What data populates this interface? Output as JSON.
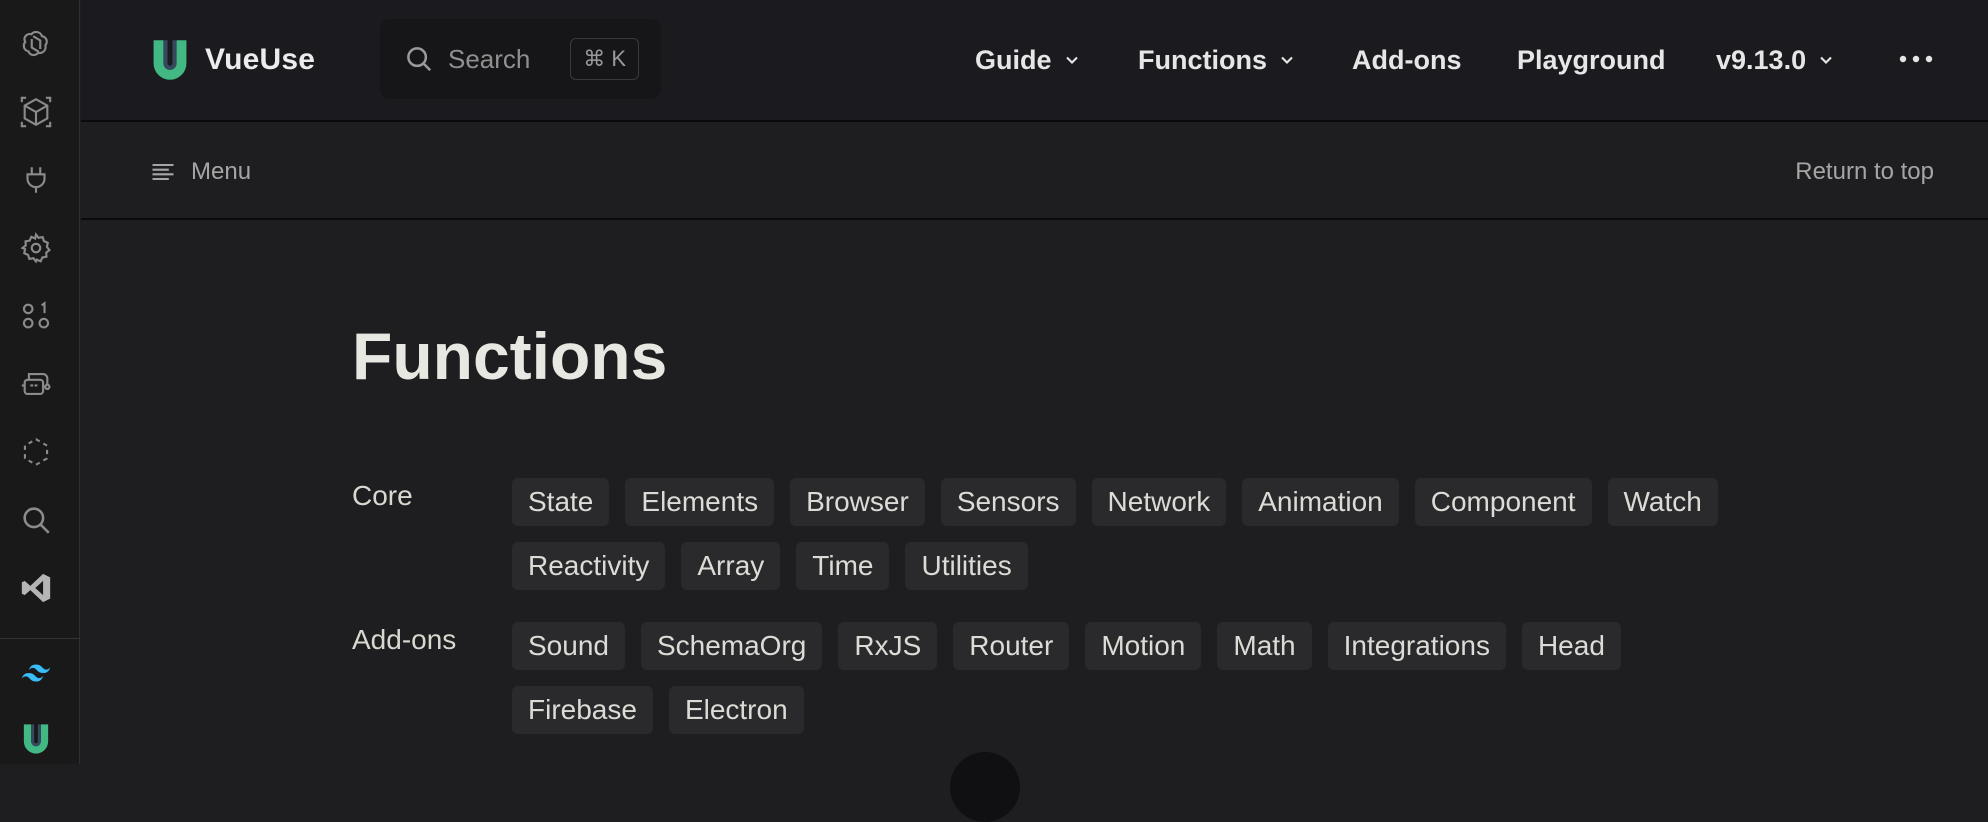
{
  "activity_bar": {
    "icons": [
      "openai-icon",
      "cube-icon",
      "plug-icon",
      "settings-gear-icon",
      "apps-icon",
      "robot-icon",
      "dashed-circle-icon",
      "search-icon",
      "vscode-icon",
      "tailwind-icon",
      "vueuse-icon"
    ]
  },
  "header": {
    "brand": "VueUse",
    "search_label": "Search",
    "search_shortcut": "⌘ K",
    "nav": {
      "guide": "Guide",
      "functions": "Functions",
      "addons": "Add-ons",
      "playground": "Playground",
      "version": "v9.13.0"
    }
  },
  "subnav": {
    "menu": "Menu",
    "return_top": "Return to top"
  },
  "main": {
    "title": "Functions",
    "categories": [
      {
        "label": "Core",
        "tags": [
          "State",
          "Elements",
          "Browser",
          "Sensors",
          "Network",
          "Animation",
          "Component",
          "Watch",
          "Reactivity",
          "Array",
          "Time",
          "Utilities"
        ]
      },
      {
        "label": "Add-ons",
        "tags": [
          "Sound",
          "SchemaOrg",
          "RxJS",
          "Router",
          "Motion",
          "Math",
          "Integrations",
          "Head",
          "Firebase",
          "Electron"
        ]
      }
    ]
  },
  "colors": {
    "brand_green": "#42b883",
    "brand_dark_green": "#35495e",
    "background": "#1e1e20",
    "tag_bg": "#2a2a2d"
  }
}
